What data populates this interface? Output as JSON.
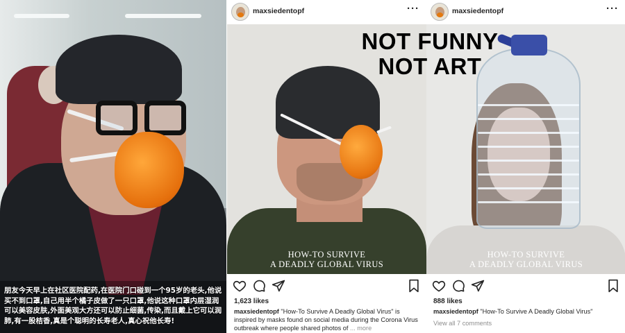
{
  "left_photo": {
    "caption": "朋友今天早上在社区医院配药,在医院门口碰到一个95岁的老头,他说买不到口罩,自己用半个橘子皮做了一只口罩,他说这种口罩内层湿润可以美容皮肤,外面美观大方还可以防止细菌,传染,而且戴上它可以润肺,有一股桔香,真是个聪明的长寿老人,真心祝他长寿!"
  },
  "headline": {
    "line1": "NOT FUNNY",
    "line2": "NOT ART"
  },
  "posts": [
    {
      "username": "maxsiedentopf",
      "more": "···",
      "photo_title_line1": "HOW-TO SURVIVE",
      "photo_title_line2": "A DEADLY GLOBAL VIRUS",
      "likes": "1,623 likes",
      "caption_user": "maxsiedentopf",
      "caption_text": " \"How-To Survive A Deadly Global Virus\" is inspired by masks found on social media during the Corona Virus outbreak where people shared photos of",
      "caption_more": "... more",
      "view_all": ""
    },
    {
      "username": "maxsiedentopf",
      "more": "···",
      "photo_title_line1": "HOW-TO SURVIVE",
      "photo_title_line2": "A DEADLY GLOBAL VIRUS",
      "likes": "888 likes",
      "caption_user": "maxsiedentopf",
      "caption_text": " \"How-To Survive A Deadly Global Virus\"",
      "caption_more": "",
      "view_all": "View all 7 comments"
    }
  ],
  "icons": [
    "heart-icon",
    "comment-icon",
    "share-icon",
    "bookmark-icon",
    "more-icon"
  ],
  "colors": {
    "text": "#262626",
    "muted": "#8e8e8e",
    "orange": "#e67410",
    "cap_blue": "#3a4fa8"
  }
}
